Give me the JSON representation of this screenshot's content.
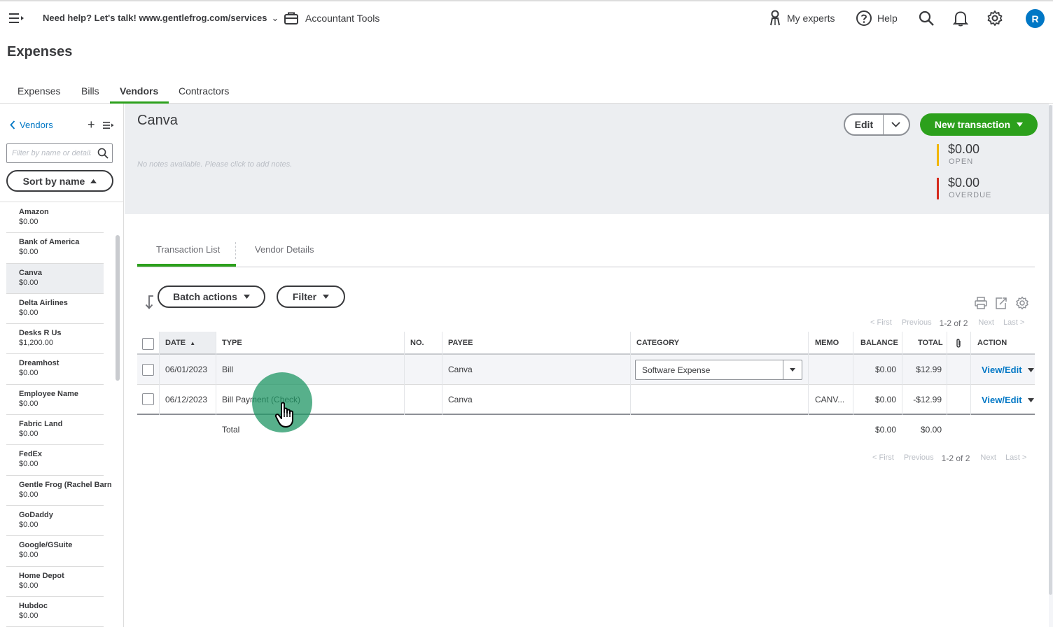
{
  "topbar": {
    "help_text": "Need help? Let's talk! www.gentlefrog.com/services",
    "accountant_tools": "Accountant Tools",
    "my_experts": "My experts",
    "help": "Help",
    "avatar_initial": "R"
  },
  "page_title": "Expenses",
  "main_tabs": [
    "Expenses",
    "Bills",
    "Vendors",
    "Contractors"
  ],
  "main_tabs_active": "Vendors",
  "sidebar": {
    "back_label": "Vendors",
    "filter_placeholder": "Filter by name or details",
    "sort_label": "Sort by name",
    "vendors": [
      {
        "name": "Amazon",
        "balance": "$0.00"
      },
      {
        "name": "Bank of America",
        "balance": "$0.00"
      },
      {
        "name": "Canva",
        "balance": "$0.00"
      },
      {
        "name": "Delta Airlines",
        "balance": "$0.00"
      },
      {
        "name": "Desks R Us",
        "balance": "$1,200.00"
      },
      {
        "name": "Dreamhost",
        "balance": "$0.00"
      },
      {
        "name": "Employee Name",
        "balance": "$0.00"
      },
      {
        "name": "Fabric Land",
        "balance": "$0.00"
      },
      {
        "name": "FedEx",
        "balance": "$0.00"
      },
      {
        "name": "Gentle Frog (Rachel Barn",
        "balance": "$0.00"
      },
      {
        "name": "GoDaddy",
        "balance": "$0.00"
      },
      {
        "name": "Google/GSuite",
        "balance": "$0.00"
      },
      {
        "name": "Home Depot",
        "balance": "$0.00"
      },
      {
        "name": "Hubdoc",
        "balance": "$0.00"
      }
    ],
    "selected_vendor": "Canva"
  },
  "vendor": {
    "name": "Canva",
    "notes_placeholder": "No notes available. Please click to add notes.",
    "edit_label": "Edit",
    "new_transaction_label": "New transaction",
    "open_amount": "$0.00",
    "open_label": "OPEN",
    "overdue_amount": "$0.00",
    "overdue_label": "OVERDUE",
    "open_color": "#f2b600",
    "overdue_color": "#d52b1e"
  },
  "inner_tabs": [
    "Transaction List",
    "Vendor Details"
  ],
  "toolbar": {
    "batch_actions": "Batch actions",
    "filter": "Filter"
  },
  "pager": {
    "first": "< First",
    "previous": "Previous",
    "range": "1-2 of 2",
    "next": "Next",
    "last": "Last >"
  },
  "table": {
    "headers": {
      "date": "DATE",
      "type": "TYPE",
      "no": "NO.",
      "payee": "PAYEE",
      "category": "CATEGORY",
      "memo": "MEMO",
      "balance": "BALANCE",
      "total": "TOTAL",
      "action": "ACTION"
    },
    "rows": [
      {
        "date": "06/01/2023",
        "type": "Bill",
        "no": "",
        "payee": "Canva",
        "category": "Software Expense",
        "memo": "",
        "balance": "$0.00",
        "total": "$12.99",
        "action": "View/Edit"
      },
      {
        "date": "06/12/2023",
        "type": "Bill Payment (Check)",
        "no": "",
        "payee": "Canva",
        "category": "",
        "memo": "CANV...",
        "balance": "$0.00",
        "total": "-$12.99",
        "action": "View/Edit"
      }
    ],
    "total_label": "Total",
    "total_balance": "$0.00",
    "total_total": "$0.00"
  },
  "colors": {
    "accent_green": "#2ca01c",
    "link_blue": "#0077c5"
  }
}
